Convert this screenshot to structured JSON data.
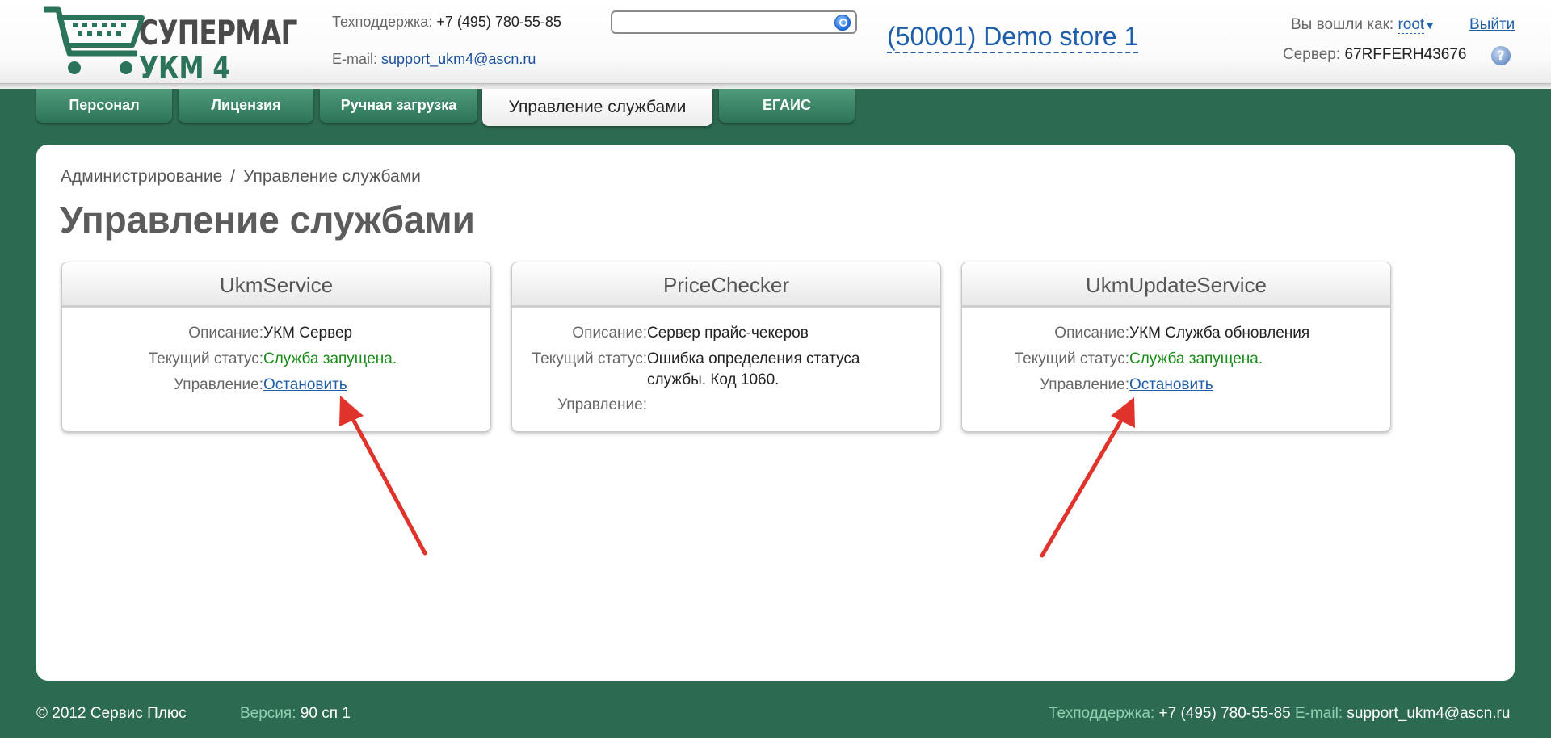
{
  "header": {
    "logo_line1": "СУПЕРМАГ",
    "logo_line2": "УКМ 4",
    "support_label": "Техподдержка:",
    "support_phone": "+7 (495) 780-55-85",
    "email_label": "E-mail:",
    "email": "support_ukm4@ascn.ru",
    "search": {
      "value": "",
      "placeholder": ""
    },
    "store": "(50001) Demo store 1",
    "login_label": "Вы вошли как:",
    "user": "root",
    "logout_label": "Выйти",
    "server_label": "Сервер:",
    "server_value": "67RFFERH43676"
  },
  "tabs": [
    {
      "label": "Персонал"
    },
    {
      "label": "Лицензия"
    },
    {
      "label": "Ручная загрузка"
    },
    {
      "label": "Управление службами",
      "active": true
    },
    {
      "label": "ЕГАИС"
    }
  ],
  "breadcrumb": {
    "root": "Администрирование",
    "separator": "/",
    "current": "Управление службами"
  },
  "page_title": "Управление службами",
  "services": [
    {
      "name": "UkmService",
      "description_label": "Описание:",
      "description": "УКМ Сервер",
      "status_label": "Текущий статус:",
      "status": "Служба запущена.",
      "control_label": "Управление:",
      "control": "Остановить"
    },
    {
      "name": "PriceChecker",
      "description_label": "Описание:",
      "description": "Сервер прайс-чекеров",
      "status_label": "Текущий статус:",
      "status_line1": "Ошибка определения статуса",
      "status_line2": "службы. Код 1060.",
      "control_label": "Управление:",
      "control": ""
    },
    {
      "name": "UkmUpdateService",
      "description_label": "Описание:",
      "description": "УКМ Служба обновления",
      "status_label": "Текущий статус:",
      "status": "Служба запущена.",
      "control_label": "Управление:",
      "control": "Остановить"
    }
  ],
  "footer": {
    "copyright": "© 2012 Сервис Плюс",
    "version_label": "Версия:",
    "version": "90 сп 1",
    "support_label": "Техподдержка:",
    "support_phone": "+7 (495) 780-55-85",
    "email_label": "E-mail:",
    "email": "support_ukm4@ascn.ru"
  },
  "colors": {
    "brand_green": "#2d6a52",
    "link_blue": "#1f5ea8",
    "status_ok": "#1a8a1a",
    "annotation_red": "#e0332b"
  }
}
